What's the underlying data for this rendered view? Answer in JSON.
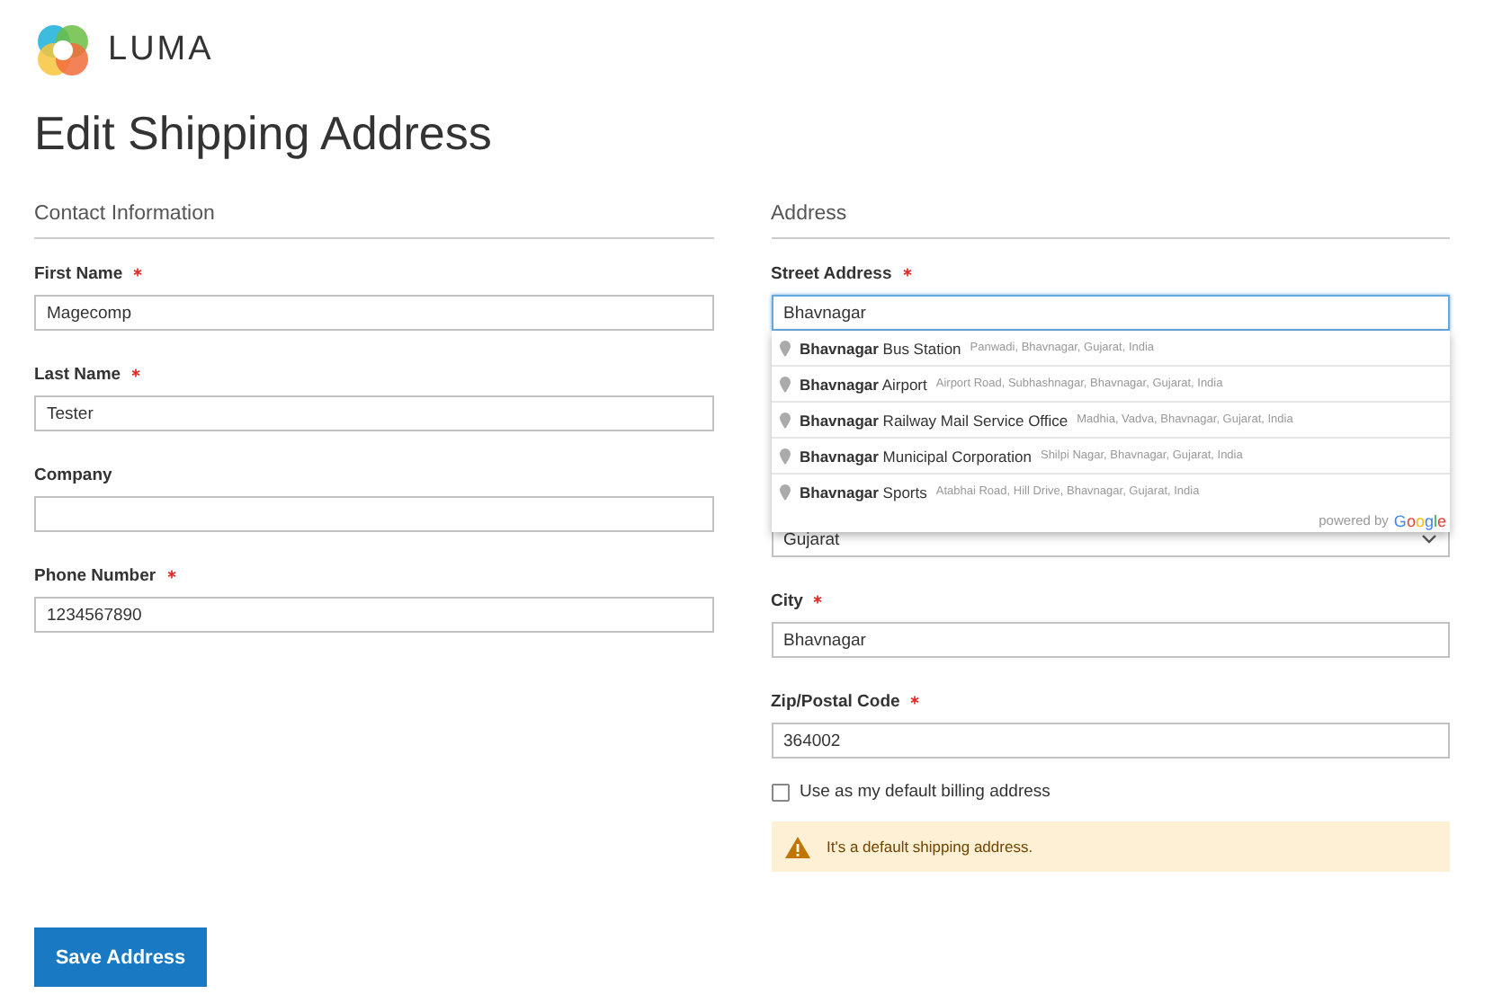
{
  "logo": {
    "text": "LUMA"
  },
  "page_title": "Edit Shipping Address",
  "contact": {
    "heading": "Contact Information",
    "fields": [
      {
        "kind": "input",
        "label": "First Name",
        "required": true,
        "value": "Magecomp"
      },
      {
        "kind": "input",
        "label": "Last Name",
        "required": true,
        "value": "Tester"
      },
      {
        "kind": "input",
        "label": "Company",
        "required": false
      },
      {
        "kind": "input",
        "label": "Phone Number",
        "required": true,
        "value": "1234567890"
      }
    ]
  },
  "address": {
    "heading": "Address",
    "fields": [
      {
        "kind": "input",
        "label": "Street Address",
        "required": true,
        "value": "Bhavnagar",
        "focused": true
      },
      {
        "kind": "select",
        "value": "Gujarat"
      },
      {
        "kind": "input",
        "label": "City",
        "required": true,
        "value": "Bhavnagar"
      },
      {
        "kind": "input",
        "label": "Zip/Postal Code",
        "required": true,
        "value": "364002"
      }
    ]
  },
  "autocomplete": {
    "suggestions": [
      {
        "main": "**Bhavnagar** Bus Station",
        "secondary": "Panwadi, Bhavnagar, Gujarat, India"
      },
      {
        "main": "**Bhavnagar** Airport",
        "secondary": "Airport Road, Subhashnagar, Bhavnagar, Gujarat, India"
      },
      {
        "main": "**Bhavnagar** Railway Mail Service Office",
        "secondary": "Madhia, Vadva, Bhavnagar, Gujarat, India"
      },
      {
        "main": "**Bhavnagar** Municipal Corporation",
        "secondary": "Shilpi Nagar, Bhavnagar, Gujarat, India"
      },
      {
        "main": "**Bhavnagar** Sports",
        "secondary": "Atabhai Road, Hill Drive, Bhavnagar, Gujarat, India"
      }
    ],
    "attribution": "powered by",
    "brand": "Google"
  },
  "default_billing": {
    "label": "Use as my default billing address",
    "checked": false
  },
  "notice": "It's a default shipping address.",
  "save_button": "Save Address"
}
